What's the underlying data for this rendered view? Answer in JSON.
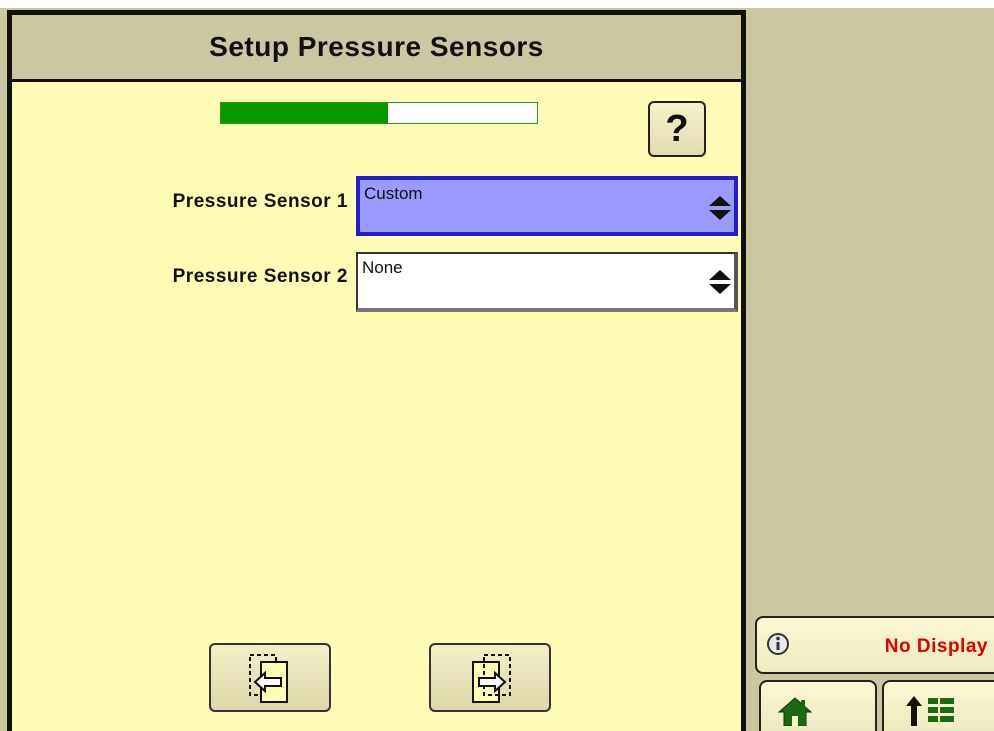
{
  "wizard": {
    "title": "Setup Pressure Sensors",
    "progress_fraction": 0.53,
    "help_label": "?"
  },
  "fields": [
    {
      "label": "Pressure Sensor 1",
      "value": "Custom",
      "state": "selected"
    },
    {
      "label": "Pressure Sensor 2",
      "value": "None",
      "state": "normal"
    }
  ],
  "navigation": {
    "back_icon": "page-back-icon",
    "next_icon": "page-next-icon"
  },
  "status": {
    "icon": "info-icon",
    "text": "No Display",
    "text_color": "#e00000"
  },
  "bottom_bar": {
    "home_icon": "home-icon",
    "menu_icon": "up-arrow-list-icon"
  },
  "colors": {
    "panel_background": "#fffcb5",
    "header_background": "#cbc8a1",
    "progress_green": "#079a00",
    "selected_field_fill": "#9b9bff",
    "selected_field_border": "#1e1ecc"
  }
}
